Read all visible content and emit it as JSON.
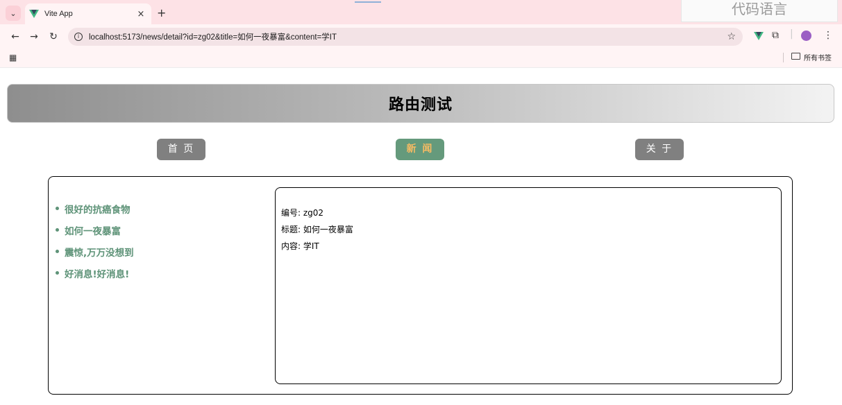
{
  "browser": {
    "tab_title": "Vite App",
    "tab_close": "×",
    "new_tab": "+",
    "url": "localhost:5173/news/detail?id=zg02&title=如何一夜暴富&content=学IT",
    "bookmarks_all": "所有书签",
    "corner_label": "代码语言"
  },
  "page": {
    "title": "路由测试",
    "nav": [
      {
        "label": "首 页",
        "active": false
      },
      {
        "label": "新 闻",
        "active": true
      },
      {
        "label": "关 于",
        "active": false
      }
    ],
    "news_list": [
      "很好的抗癌食物",
      "如何一夜暴富",
      "震惊,万万没想到",
      "好消息!好消息!"
    ],
    "detail": {
      "id_line": "编号: zg02",
      "title_line": "标题: 如何一夜暴富",
      "content_line": "内容: 学IT"
    }
  },
  "colors": {
    "nav_default_bg": "#808080",
    "nav_active_bg": "#659a7c",
    "nav_active_text": "#f7bb63",
    "list_text": "#5e9378"
  }
}
